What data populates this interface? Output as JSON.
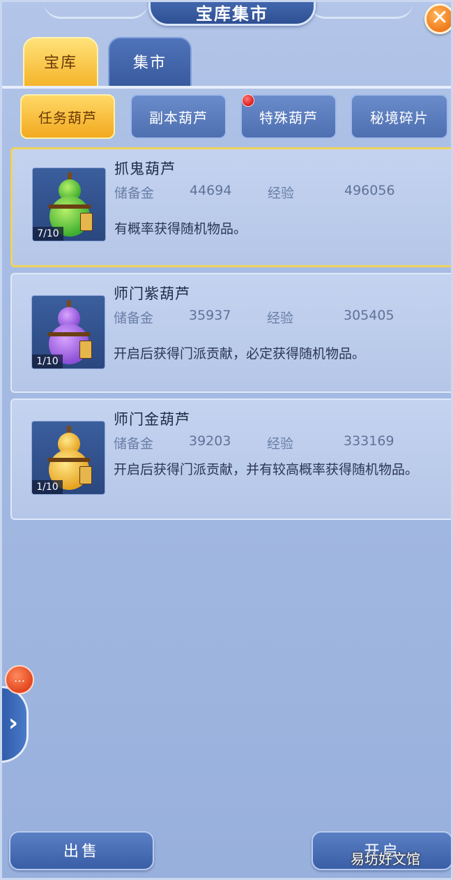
{
  "header": {
    "title": "宝库集市",
    "close_label": "✕"
  },
  "tabs": [
    {
      "label": "宝库",
      "active": true
    },
    {
      "label": "集市",
      "active": false
    }
  ],
  "subtabs": [
    {
      "label": "任务葫芦",
      "active": true
    },
    {
      "label": "副本葫芦",
      "active": false
    },
    {
      "label": "特殊葫芦",
      "active": false,
      "badge": true
    },
    {
      "label": "秘境碎片",
      "active": false
    }
  ],
  "items": [
    {
      "name": "抓鬼葫芦",
      "reserve_label": "储备金",
      "reserve_value": "44694",
      "exp_label": "经验",
      "exp_value": "496056",
      "count": "7/10",
      "desc": "有概率获得随机物品。",
      "gourd_color": "#3fae2f"
    },
    {
      "name": "师门紫葫芦",
      "reserve_label": "储备金",
      "reserve_value": "35937",
      "exp_label": "经验",
      "exp_value": "305405",
      "count": "1/10",
      "desc": "开启后获得门派贡献，必定获得随机物品。",
      "gourd_color": "#8b4fd6"
    },
    {
      "name": "师门金葫芦",
      "reserve_label": "储备金",
      "reserve_value": "39203",
      "exp_label": "经验",
      "exp_value": "333169",
      "count": "1/10",
      "desc": "开启后获得门派贡献，并有较高概率获得随机物品。",
      "gourd_color": "#e6a321"
    }
  ],
  "side": {
    "dot_label": "…",
    "arrow_label": "›"
  },
  "footer": {
    "sell_label": "出售",
    "open_label": "开启"
  },
  "watermark": "易坊好文馆",
  "colors": {
    "accent_gold": "#f2a91f",
    "panel_blue": "#3a5ea6"
  }
}
